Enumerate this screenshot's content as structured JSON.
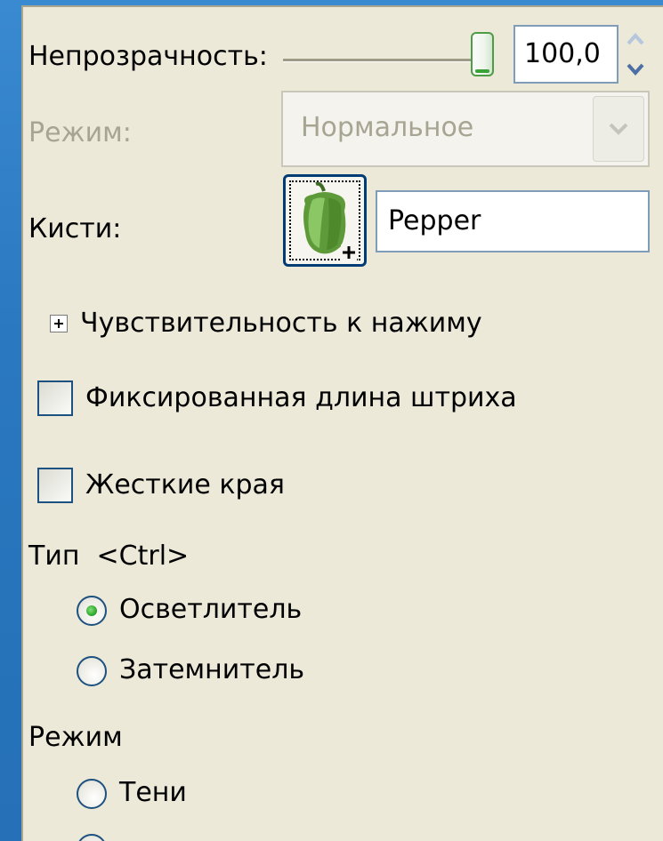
{
  "opacity": {
    "label": "Непрозрачность:",
    "value": "100,0",
    "level_fraction": 1.0
  },
  "mode": {
    "label": "Режим:",
    "selected": "Нормальное"
  },
  "brush": {
    "label": "Кисти:",
    "name": "Pepper",
    "icon": "pepper-brush-icon"
  },
  "pressure": {
    "label": "Чувствительность к нажиму"
  },
  "fixed_stroke": {
    "label": "Фиксированная длина штриха",
    "checked": false
  },
  "hard_edges": {
    "label": "Жесткие края",
    "checked": false
  },
  "type_group": {
    "label": "Тип  <Ctrl>",
    "options": [
      {
        "label": "Осветлитель",
        "checked": true
      },
      {
        "label": "Затемнитель",
        "checked": false
      }
    ]
  },
  "range_group": {
    "label": "Режим",
    "options": [
      {
        "label": "Тени",
        "checked": false
      }
    ]
  },
  "colors": {
    "accent_green": "#27a123",
    "border_blue": "#1c5180",
    "panel_bg": "#ece9d8"
  }
}
